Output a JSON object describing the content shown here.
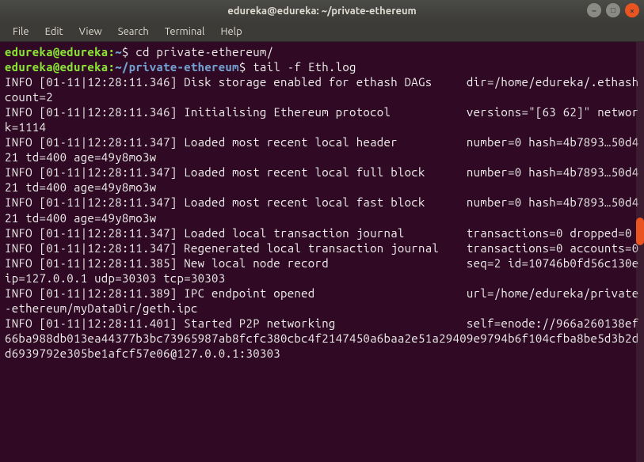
{
  "window": {
    "title": "edureka@edureka: ~/private-ethereum"
  },
  "menu": {
    "file": "File",
    "edit": "Edit",
    "view": "View",
    "search": "Search",
    "terminal": "Terminal",
    "help": "Help"
  },
  "prompt1": {
    "user_host": "edureka@edureka",
    "colon": ":",
    "path": "~",
    "dollar": "$",
    "command": "cd private-ethereum/"
  },
  "prompt2": {
    "user_host": "edureka@edureka",
    "colon": ":",
    "path": "~/private-ethereum",
    "dollar": "$",
    "command": "tail -f Eth.log"
  },
  "logs": {
    "l1": "INFO [01-11|12:28:11.346] Disk storage enabled for ethash DAGs     dir=/home/edureka/.ethash                        count=2",
    "l2": "INFO [01-11|12:28:11.346] Initialising Ethereum protocol           versions=\"[63 62]\" network=1114",
    "l3": "INFO [01-11|12:28:11.347] Loaded most recent local header          number=0 hash=4b7893…50d421 td=400 age=49y8mo3w",
    "l4": "INFO [01-11|12:28:11.347] Loaded most recent local full block      number=0 hash=4b7893…50d421 td=400 age=49y8mo3w",
    "l5": "INFO [01-11|12:28:11.347] Loaded most recent local fast block      number=0 hash=4b7893…50d421 td=400 age=49y8mo3w",
    "l6": "INFO [01-11|12:28:11.347] Loaded local transaction journal         transactions=0 dropped=0",
    "l7": "INFO [01-11|12:28:11.347] Regenerated local transaction journal    transactions=0 accounts=0",
    "l8": "INFO [01-11|12:28:11.385] New local node record                    seq=2 id=10746b0fd56c130e ip=127.0.0.1 udp=30303 tcp=30303",
    "l9": "INFO [01-11|12:28:11.389] IPC endpoint opened                      url=/home/edureka/private-ethereum/myDataDir/geth.ipc",
    "l10": "INFO [01-11|12:28:11.401] Started P2P networking                   self=enode://966a260138ef66ba988db013ea44377b3bc73965987ab8fcfc380cbc4f2147450a6baa2e51a29409e9794b6f104cfba8be5d3b2dd6939792e305be1afcf57e06@127.0.0.1:30303"
  },
  "window_controls": {
    "minimize": "–",
    "maximize": "□",
    "close": "×"
  }
}
